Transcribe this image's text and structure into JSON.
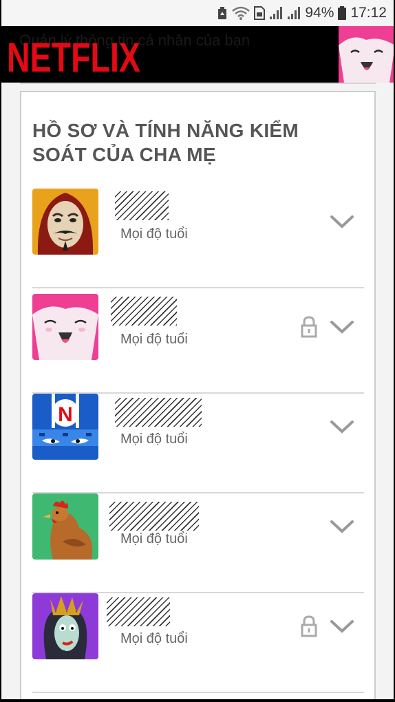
{
  "status_bar": {
    "battery_percent": "94%",
    "time": "17:12",
    "icons": [
      "recycle-icon",
      "wifi-icon",
      "sim-icon",
      "signal-icon",
      "signal-icon",
      "battery-icon"
    ]
  },
  "header": {
    "logo_text": "NETFLIX",
    "background_text": "Quản lý thông tin cá nhân của bạn",
    "brand_color": "#e50914"
  },
  "section": {
    "title": "HỒ SƠ VÀ TÍNH NĂNG KIỂM SOÁT CỦA CHA MẸ"
  },
  "profiles": [
    {
      "avatar": "money-heist-mask-avatar",
      "maturity": "Mọi độ tuổi",
      "locked": false,
      "name_redacted": true
    },
    {
      "avatar": "pink-kid-avatar",
      "maturity": "Mọi độ tuổi",
      "locked": true,
      "name_redacted": true
    },
    {
      "avatar": "blue-netflix-helmet-avatar",
      "maturity": "Mọi độ tuổi",
      "locked": false,
      "name_redacted": true
    },
    {
      "avatar": "chicken-avatar",
      "maturity": "Mọi độ tuổi",
      "locked": false,
      "name_redacted": true
    },
    {
      "avatar": "queen-avatar",
      "maturity": "Mọi độ tuổi",
      "locked": true,
      "name_redacted": true
    }
  ]
}
